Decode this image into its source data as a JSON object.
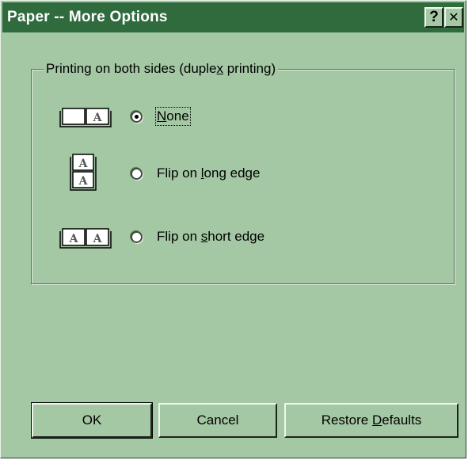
{
  "window": {
    "title": "Paper -- More Options",
    "help_button": "?",
    "close_button": "✕"
  },
  "group": {
    "label_before": "Printing on both sides (duple",
    "label_mnemonic": "x",
    "label_after": " printing)"
  },
  "options": [
    {
      "mnemonic": "N",
      "rest": "one",
      "pre": "",
      "checked": true,
      "focused": true,
      "icon": "open-book-single-page-icon"
    },
    {
      "pre": "Flip on ",
      "mnemonic": "l",
      "rest": "ong edge",
      "checked": false,
      "icon": "stacked-pages-icon"
    },
    {
      "pre": "Flip on ",
      "mnemonic": "s",
      "rest": "hort edge",
      "checked": false,
      "icon": "open-book-both-pages-icon"
    }
  ],
  "buttons": {
    "ok": "OK",
    "cancel": "Cancel",
    "restore_before": "Restore ",
    "restore_mnemonic": "D",
    "restore_after": "efaults"
  },
  "colors": {
    "face": "#a5c8a4",
    "titlebar": "#2f6b3d",
    "title_text": "#ffffff"
  }
}
